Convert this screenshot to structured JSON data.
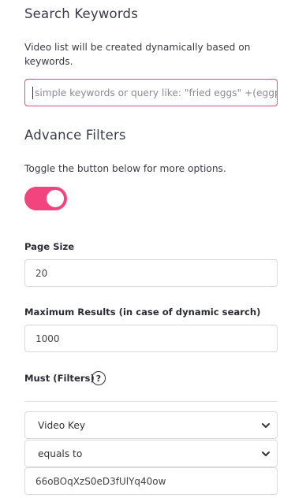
{
  "search": {
    "title": "Search Keywords",
    "description": "Video list will be created dynamically based on keywords.",
    "placeholder": "simple keywords or query like: \"fried eggs\" +(eggplant | potato) -frittata"
  },
  "advance": {
    "title": "Advance Filters",
    "description": "Toggle the button below for more options.",
    "toggle_state": "on"
  },
  "page_size": {
    "label": "Page Size",
    "value": "20"
  },
  "max_results": {
    "label": "Maximum Results (in case of dynamic search)",
    "value": "1000"
  },
  "must": {
    "label": "Must (Filters)",
    "help_symbol": "?",
    "field_select": "Video Key",
    "operator_select": "equals to",
    "value": "66oBOqXzS0eD3fUlYq40ow"
  },
  "colors": {
    "accent": "#f2457f",
    "border": "#d9d9de"
  },
  "icons": [
    "help-icon",
    "chevron-down-icon"
  ]
}
